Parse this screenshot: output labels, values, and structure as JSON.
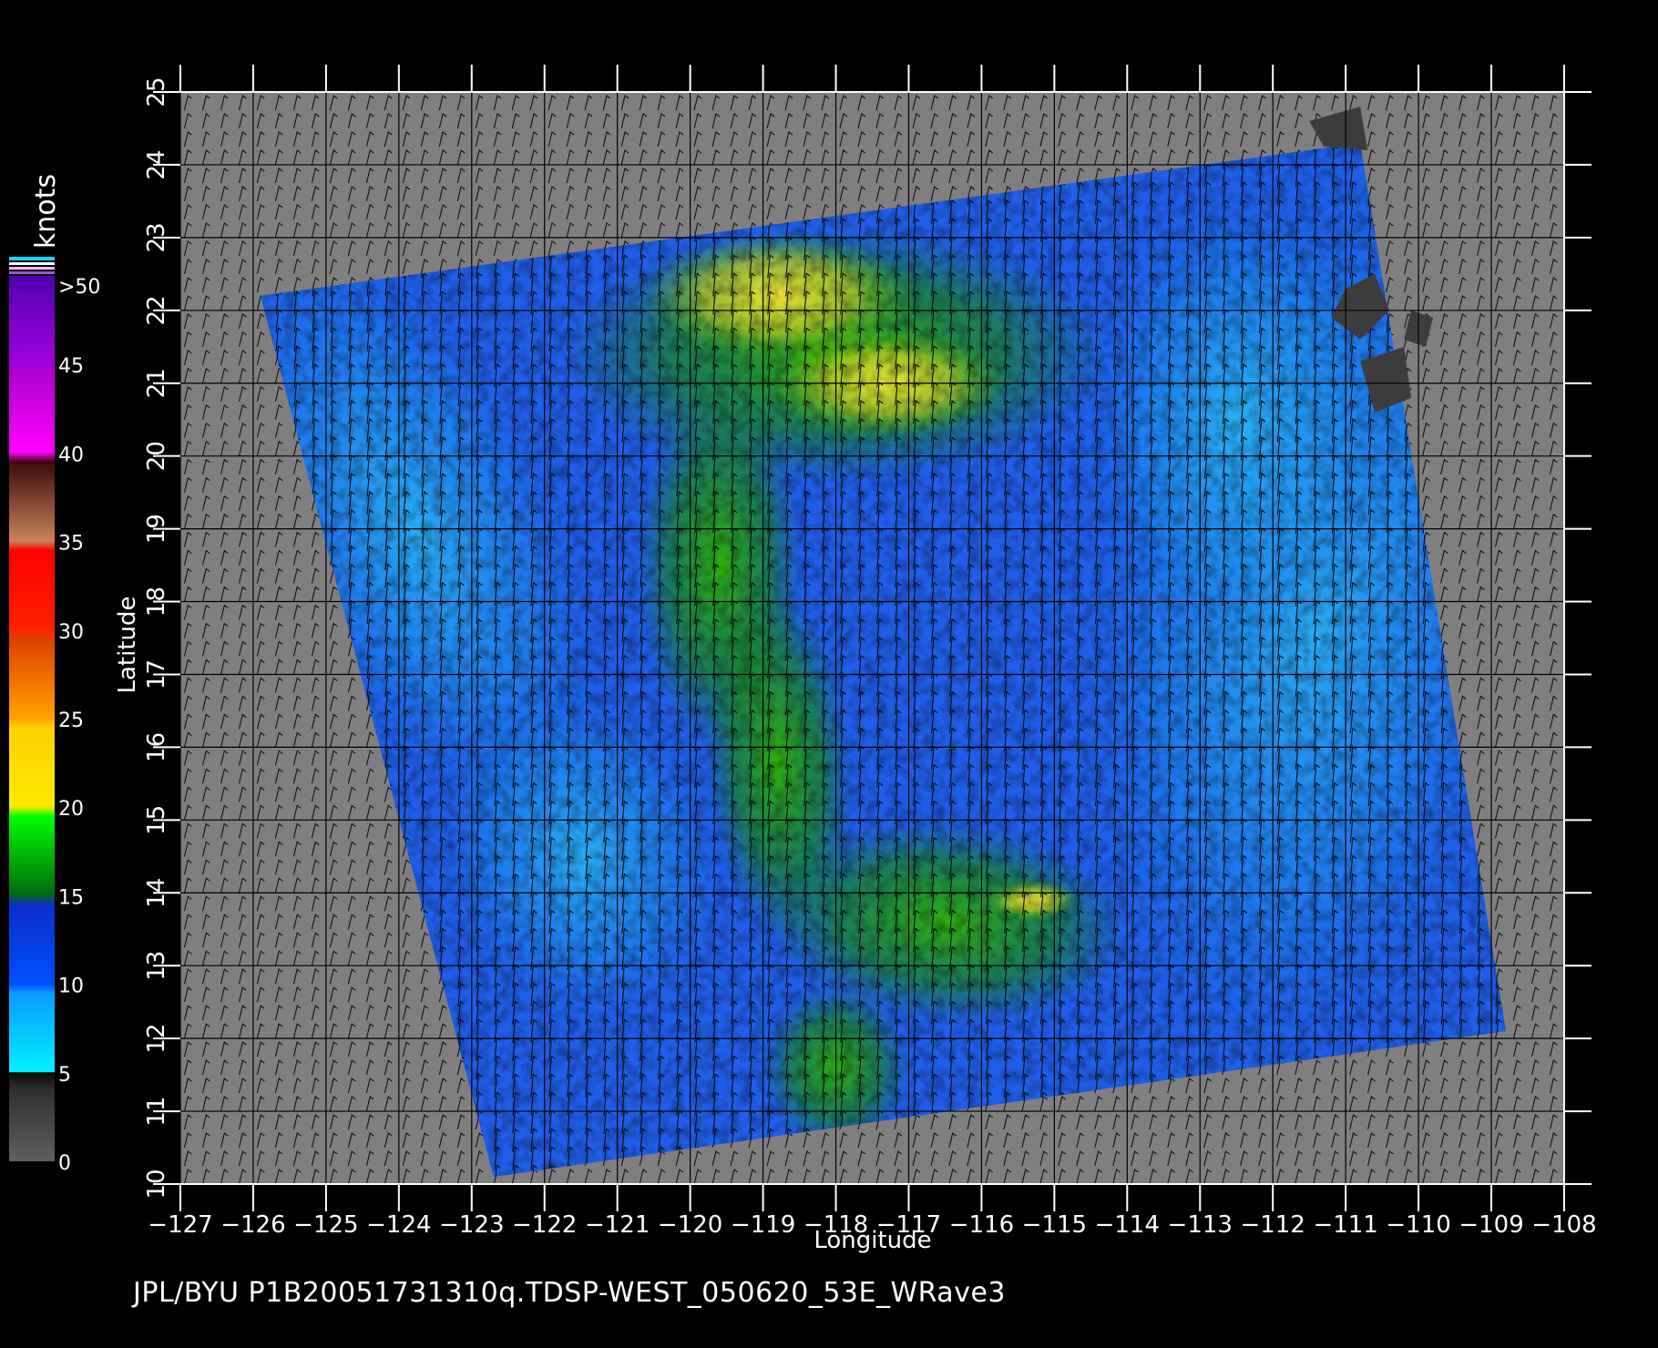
{
  "map": {
    "lon_ticks": [
      "−127",
      "−126",
      "−125",
      "−124",
      "−123",
      "−122",
      "−121",
      "−120",
      "−119",
      "−118",
      "−117",
      "−116",
      "−115",
      "−114",
      "−113",
      "−112",
      "−111",
      "−110",
      "−109",
      "−108"
    ],
    "lat_ticks": [
      "10",
      "11",
      "12",
      "13",
      "14",
      "15",
      "16",
      "17",
      "18",
      "19",
      "20",
      "21",
      "22",
      "23",
      "24",
      "25"
    ],
    "x_axis_label": "Longitude",
    "y_axis_label": "Latitude",
    "lon_range": [
      -127,
      -108
    ],
    "lat_range": [
      10,
      25
    ],
    "swath_corners_lonlat": [
      [
        -125.9,
        22.2
      ],
      [
        -110.8,
        24.3
      ],
      [
        -108.8,
        12.1
      ],
      [
        -122.7,
        10.1
      ]
    ],
    "grid": true,
    "background_color": "#7f7f7f",
    "land_color": "#3c3c3c"
  },
  "colorbar": {
    "unit_label": "knots",
    "labels": [
      ">50",
      "45",
      "40",
      "35",
      "30",
      "25",
      "20",
      "15",
      "10",
      "5",
      "0"
    ],
    "range": [
      0,
      50
    ]
  },
  "footer": {
    "caption": "JPL/BYU  P1B20051731310q.TDSP-WEST_050620_53E_WRave3"
  }
}
